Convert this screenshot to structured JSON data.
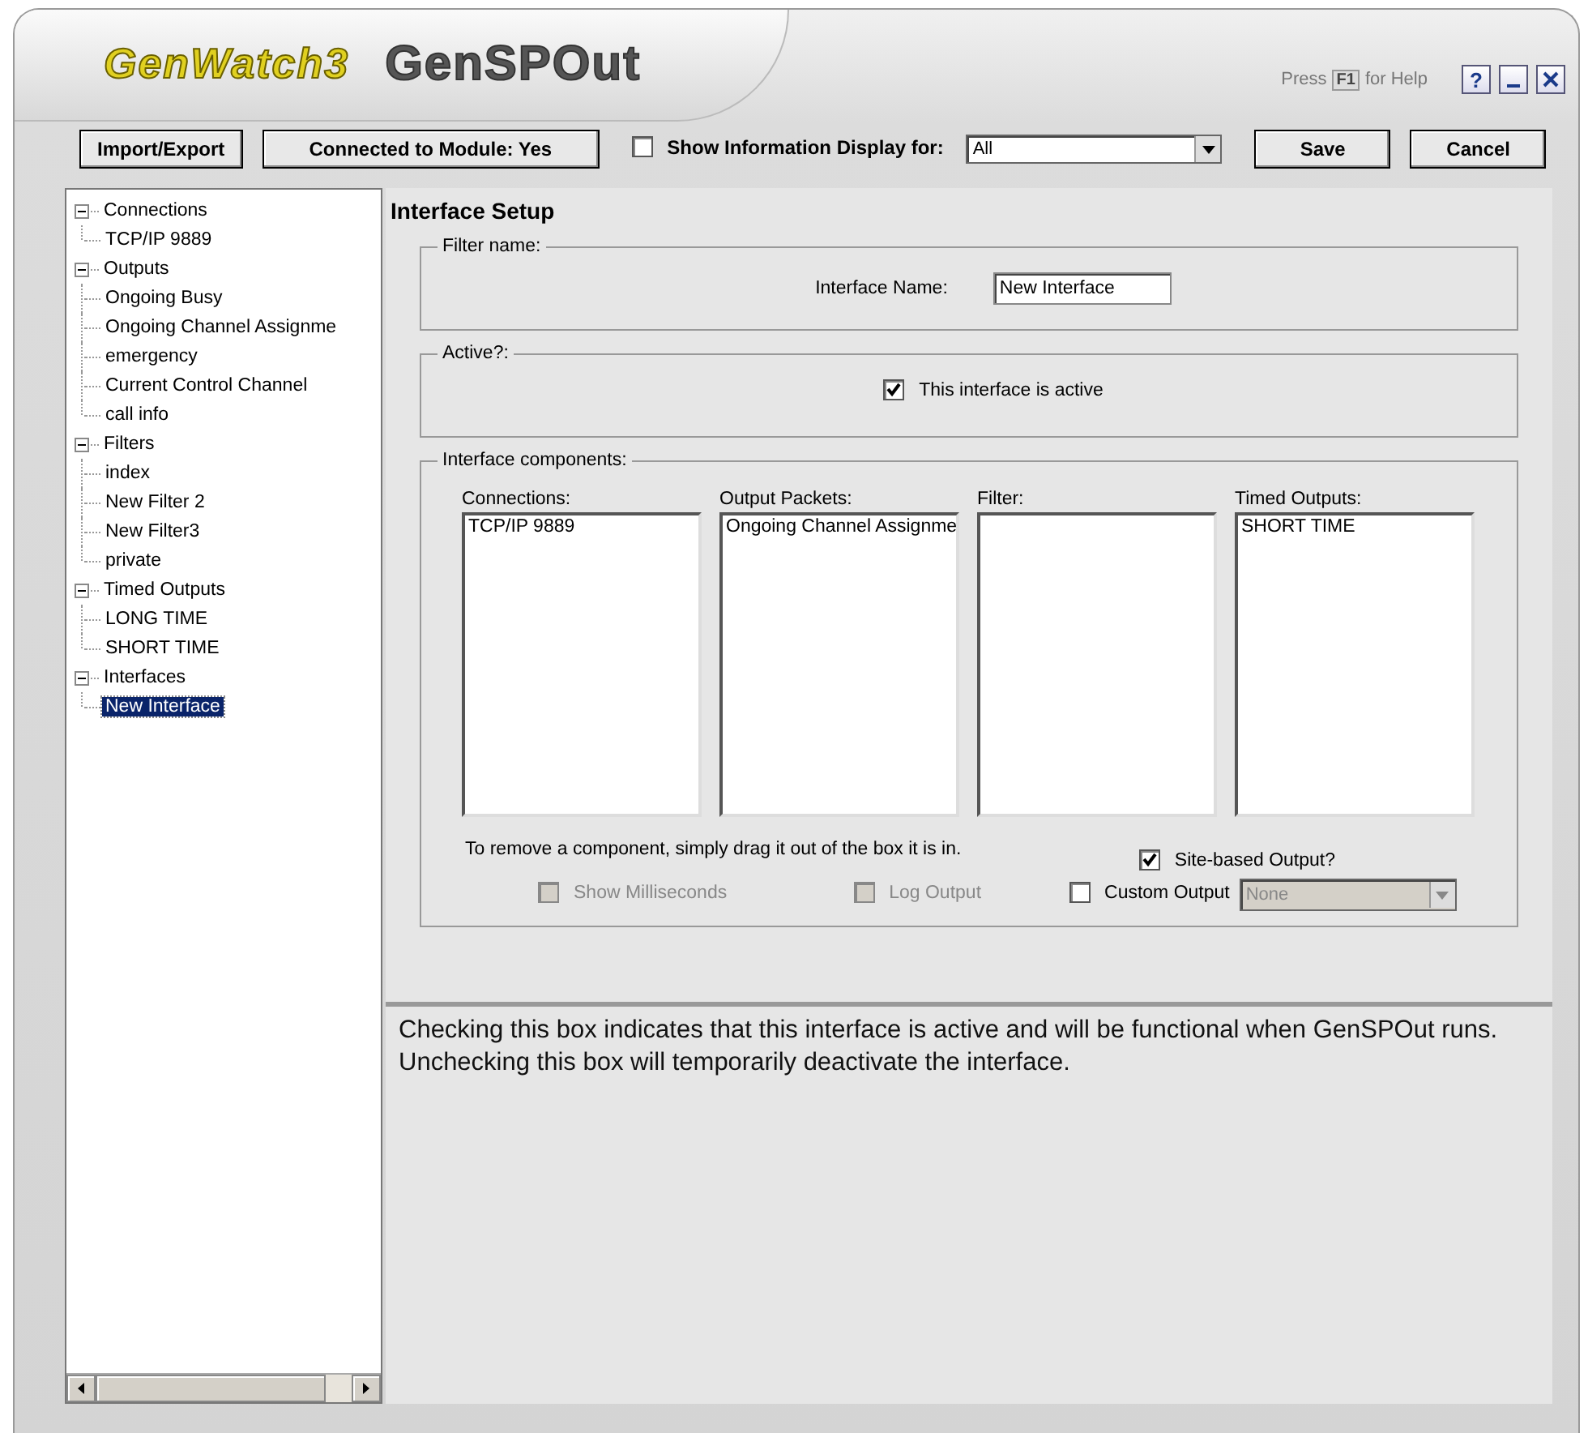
{
  "header": {
    "logo": "GenWatch3",
    "title": "GenSPOut",
    "help": {
      "before": "Press",
      "key": "F1",
      "after": "for Help"
    },
    "help_button": "?"
  },
  "toolbar": {
    "import_button": "Import/Export",
    "connected_button": "Connected to Module: Yes",
    "show_info": {
      "label": "Show Information Display for:",
      "checked": false
    },
    "display_for": "All",
    "save": "Save",
    "cancel": "Cancel"
  },
  "tree": [
    {
      "label": "Connections",
      "expanded": true,
      "selected": false,
      "children": [
        {
          "label": "TCP/IP 9889",
          "selected": false
        }
      ]
    },
    {
      "label": "Outputs",
      "expanded": true,
      "selected": false,
      "children": [
        {
          "label": "Ongoing Busy",
          "selected": false
        },
        {
          "label": "Ongoing Channel Assignme",
          "selected": false
        },
        {
          "label": "emergency",
          "selected": false
        },
        {
          "label": "Current Control Channel",
          "selected": false
        },
        {
          "label": "call info",
          "selected": false
        }
      ]
    },
    {
      "label": "Filters",
      "expanded": true,
      "selected": false,
      "children": [
        {
          "label": "index",
          "selected": false
        },
        {
          "label": "New Filter 2",
          "selected": false
        },
        {
          "label": "New Filter3",
          "selected": false
        },
        {
          "label": "private",
          "selected": false
        }
      ]
    },
    {
      "label": "Timed Outputs",
      "expanded": true,
      "selected": false,
      "children": [
        {
          "label": "LONG TIME",
          "selected": false
        },
        {
          "label": "SHORT TIME",
          "selected": false
        }
      ]
    },
    {
      "label": "Interfaces",
      "expanded": true,
      "selected": false,
      "children": [
        {
          "label": "New Interface",
          "selected": true
        }
      ]
    }
  ],
  "setup": {
    "heading": "Interface Setup",
    "filter_group": {
      "legend": "Filter name:",
      "field_label": "Interface Name:",
      "field_value": "New Interface"
    },
    "active_group": {
      "legend": "Active?:",
      "checkbox": {
        "label": "This interface is active",
        "checked": true
      }
    },
    "components": {
      "legend": "Interface components:",
      "lists": [
        {
          "label": "Connections:",
          "items": [
            "TCP/IP 9889"
          ]
        },
        {
          "label": "Output Packets:",
          "items": [
            "Ongoing Channel Assignme"
          ]
        },
        {
          "label": "Filter:"
        },
        {
          "label": "Timed Outputs:",
          "items": [
            "SHORT TIME"
          ]
        }
      ],
      "note": "To remove a component, simply drag it out of the box it is in.",
      "site_based": {
        "label": "Site-based Output?",
        "checked": true,
        "disabled": false
      },
      "show_ms": {
        "label": "Show Milliseconds",
        "checked": false,
        "disabled": true
      },
      "log_output": {
        "label": "Log Output",
        "checked": false,
        "disabled": true
      },
      "custom_output": {
        "label": "Custom Output",
        "checked": false,
        "disabled": false
      },
      "custom_select": {
        "value": "None",
        "disabled": true
      }
    }
  },
  "description": "Checking this box indicates that this interface is active and will be functional when GenSPOut runs.  Unchecking this box will temporarily deactivate the interface."
}
